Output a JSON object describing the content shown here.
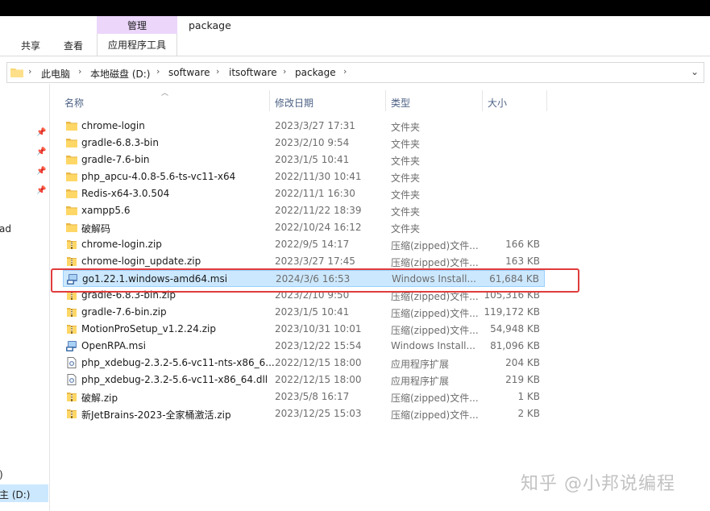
{
  "window": {
    "title": "package"
  },
  "ribbon": {
    "manage_label": "管理",
    "tabs": [
      "共享",
      "查看",
      "应用程序工具"
    ]
  },
  "address": {
    "crumbs": [
      "此电脑",
      "本地磁盘 (D:)",
      "software",
      "itsoftware",
      "package"
    ]
  },
  "nav": {
    "partial_items": [
      "ad",
      "",
      ")",
      "主 (D:)"
    ]
  },
  "columns": {
    "name": "名称",
    "date": "修改日期",
    "type": "类型",
    "size": "大小"
  },
  "files": [
    {
      "name": "chrome-login",
      "date": "2023/3/27 17:31",
      "type": "文件夹",
      "size": "",
      "icon": "folder"
    },
    {
      "name": "gradle-6.8.3-bin",
      "date": "2023/2/10 9:54",
      "type": "文件夹",
      "size": "",
      "icon": "folder"
    },
    {
      "name": "gradle-7.6-bin",
      "date": "2023/1/5 10:41",
      "type": "文件夹",
      "size": "",
      "icon": "folder"
    },
    {
      "name": "php_apcu-4.0.8-5.6-ts-vc11-x64",
      "date": "2022/11/30 10:41",
      "type": "文件夹",
      "size": "",
      "icon": "folder"
    },
    {
      "name": "Redis-x64-3.0.504",
      "date": "2022/11/1 16:30",
      "type": "文件夹",
      "size": "",
      "icon": "folder"
    },
    {
      "name": "xampp5.6",
      "date": "2022/11/22 18:39",
      "type": "文件夹",
      "size": "",
      "icon": "folder"
    },
    {
      "name": "破解码",
      "date": "2022/10/24 16:12",
      "type": "文件夹",
      "size": "",
      "icon": "folder"
    },
    {
      "name": "chrome-login.zip",
      "date": "2022/9/5 14:17",
      "type": "压缩(zipped)文件...",
      "size": "166 KB",
      "icon": "zip"
    },
    {
      "name": "chrome-login_update.zip",
      "date": "2023/3/27 17:45",
      "type": "压缩(zipped)文件...",
      "size": "163 KB",
      "icon": "zip"
    },
    {
      "name": "go1.22.1.windows-amd64.msi",
      "date": "2024/3/6 16:53",
      "type": "Windows Install...",
      "size": "61,684 KB",
      "icon": "msi",
      "selected": true
    },
    {
      "name": "gradle-6.8.3-bin.zip",
      "date": "2023/2/10 9:50",
      "type": "压缩(zipped)文件...",
      "size": "105,316 KB",
      "icon": "zip"
    },
    {
      "name": "gradle-7.6-bin.zip",
      "date": "2023/1/5 10:41",
      "type": "压缩(zipped)文件...",
      "size": "119,172 KB",
      "icon": "zip"
    },
    {
      "name": "MotionProSetup_v1.2.24.zip",
      "date": "2023/10/31 10:01",
      "type": "压缩(zipped)文件...",
      "size": "54,948 KB",
      "icon": "zip"
    },
    {
      "name": "OpenRPA.msi",
      "date": "2023/12/22 15:54",
      "type": "Windows Install...",
      "size": "81,096 KB",
      "icon": "msi"
    },
    {
      "name": "php_xdebug-2.3.2-5.6-vc11-nts-x86_6...",
      "date": "2022/12/15 18:00",
      "type": "应用程序扩展",
      "size": "204 KB",
      "icon": "dll"
    },
    {
      "name": "php_xdebug-2.3.2-5.6-vc11-x86_64.dll",
      "date": "2022/12/15 18:00",
      "type": "应用程序扩展",
      "size": "219 KB",
      "icon": "dll"
    },
    {
      "name": "破解.zip",
      "date": "2023/5/8 16:17",
      "type": "压缩(zipped)文件...",
      "size": "1 KB",
      "icon": "zip"
    },
    {
      "name": "新JetBrains-2023-全家桶激活.zip",
      "date": "2023/12/25 15:03",
      "type": "压缩(zipped)文件...",
      "size": "2 KB",
      "icon": "zip"
    }
  ],
  "watermark": "知乎 @小邦说编程",
  "colors": {
    "selection": "#cce8ff",
    "highlight_box": "#e03c3c",
    "manage_tab": "#ecd6fa",
    "folder": "#f8d775"
  }
}
